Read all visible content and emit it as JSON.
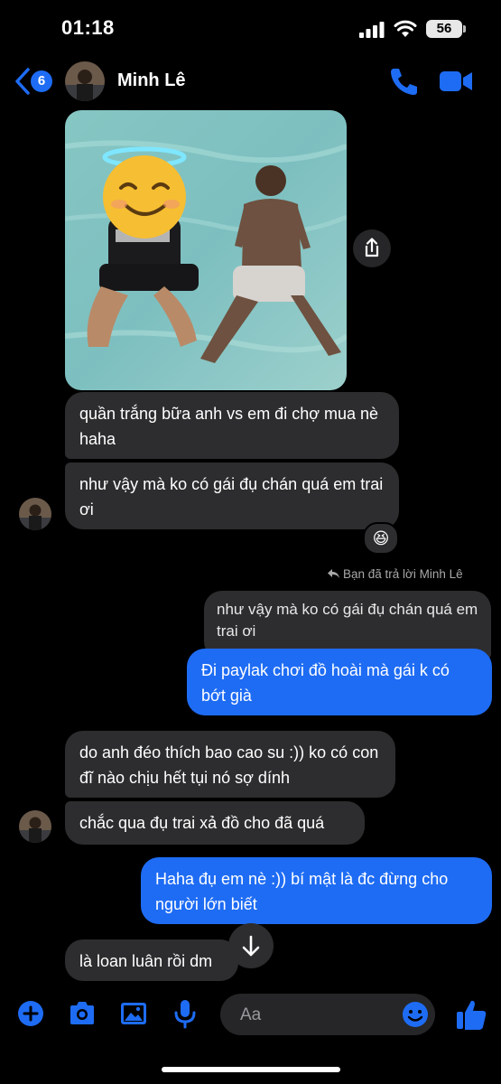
{
  "status_bar": {
    "time": "01:18",
    "battery": "56"
  },
  "header": {
    "back_badge": "6",
    "contact_name": "Minh Lê"
  },
  "messages": [
    {
      "text": "quần trắng bữa anh vs em đi chợ mua nè haha"
    },
    {
      "text": "như vậy mà ko có gái đụ chán quá em trai ơi",
      "reaction": "😆"
    },
    {
      "reply_note": "Bạn đã trả lời Minh Lê"
    },
    {
      "quoted": "như vậy mà ko có gái đụ chán quá em trai ơi"
    },
    {
      "text": "Đi paylak chơi đồ hoài mà gái k có bớt già"
    },
    {
      "text": "do anh đéo thích bao cao su :)) ko có con đĩ nào chịu hết tụi nó sợ dính"
    },
    {
      "text": "chắc qua đụ trai xả đồ cho đã quá"
    },
    {
      "text": "Haha đụ em nè :)) bí mật là đc đừng cho người lớn biết"
    },
    {
      "text": "là loan luân rồi dm"
    }
  ],
  "composer": {
    "placeholder": "Aa"
  },
  "colors": {
    "accent": "#1e6cf4",
    "incoming_bubble": "#2d2d2f",
    "background": "#000000"
  }
}
